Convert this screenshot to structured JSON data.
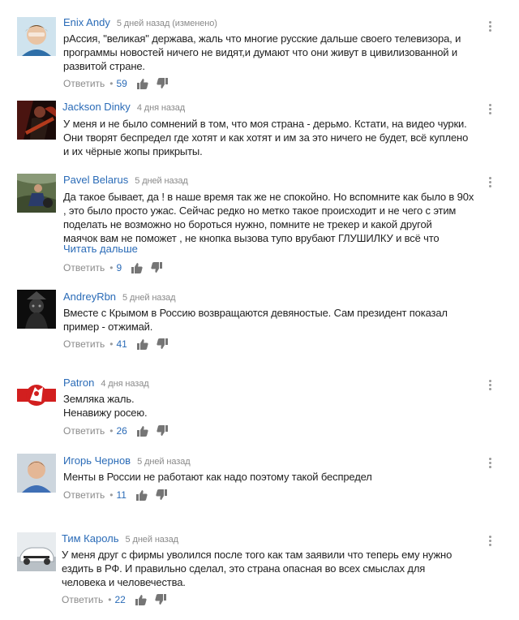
{
  "reply_label": "Ответить",
  "comments": [
    {
      "author": "Enix Andy",
      "time": "5 дней назад (изменено)",
      "lines": [
        "рАссия, \"великая\" держава, жаль что многие русские дальше своего телевизора, и",
        "программы новостей ничего не видят,и думают что они живут в цивилизованной и",
        "развитой стране."
      ],
      "likes": "59"
    },
    {
      "author": "Jackson Dinky",
      "time": "4 дня назад",
      "lines": [
        "У меня и не было сомнений в том, что моя страна - дерьмо. Кстати, на видео чурки.",
        "Они творят беспредел где хотят и как хотят и им за это ничего не будет, всё куплено",
        "и их чёрные жопы прикрыты."
      ],
      "likes": ""
    },
    {
      "author": "Pavel Belarus",
      "time": "5 дней назад",
      "lines": [
        "Да такое бывает, да ! в наше время так же не спокойно. Но вспомните как было в 90х",
        ", это было просто ужас. Сейчас редко но метко такое происходит и не чего с этим",
        "поделать не возможно но бороться нужно, помните не трекер и какой другой",
        "маячок вам не поможет , не кнопка вызова тупо врубают ГЛУШИЛКУ и всё что"
      ],
      "read_more": "Читать дальше",
      "likes": "9"
    },
    {
      "author": "AndreyRbn",
      "time": "5 дней назад",
      "lines": [
        "Вместе с Крымом в Россию возвращаются девяностые. Сам президент показал",
        "пример - отжимай."
      ],
      "likes": "41"
    },
    {
      "author": "Patron",
      "time": "4 дня назад",
      "lines": [
        "Земляка жаль.",
        "Ненавижу росею."
      ],
      "likes": "26"
    },
    {
      "author": "Игорь Чернов",
      "time": "5 дней назад",
      "lines": [
        "Менты в России не работают как надо поэтому такой беспредел"
      ],
      "likes": "11"
    },
    {
      "author": "Тим Кароль",
      "time": "5 дней назад",
      "lines": [
        "У меня друг с фирмы уволился после того как там заявили что теперь ему нужно",
        "ездить в РФ. И правильно сделал, это страна опасная во всех смыслах для",
        "человека и человечества."
      ],
      "likes": "22"
    }
  ]
}
